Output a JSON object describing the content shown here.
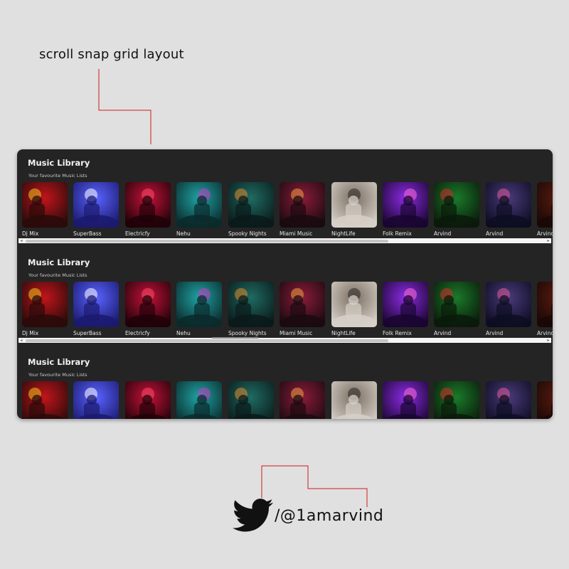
{
  "caption": "scroll snap grid layout",
  "panels": [
    {
      "title": "Music Library",
      "subtitle": "Your favourite Music Lists"
    },
    {
      "title": "Music Library",
      "subtitle": "Your favourite Music Lists"
    },
    {
      "title": "Music Library",
      "subtitle": "Your favourite Music Lists"
    }
  ],
  "cards": [
    {
      "label": "Dj Mix",
      "palette": [
        "#2a0a0a",
        "#c0151b",
        "#f2c21b"
      ],
      "image_icon": "dj-mix-image"
    },
    {
      "label": "SuperBass",
      "palette": [
        "#1b1a6e",
        "#5a63ff",
        "#ffffff"
      ],
      "image_icon": "concert-crowd-image"
    },
    {
      "label": "Electricfy",
      "palette": [
        "#200208",
        "#c4123a",
        "#ff4a6a"
      ],
      "image_icon": "stage-lights-image"
    },
    {
      "label": "Nehu",
      "palette": [
        "#0b2a2c",
        "#1fa3a3",
        "#c83bc4"
      ],
      "image_icon": "singer-portrait-image"
    },
    {
      "label": "Spooky Nights",
      "palette": [
        "#0a1a1a",
        "#1f6b62",
        "#e08a2c"
      ],
      "image_icon": "costume-party-image"
    },
    {
      "label": "Miami Music",
      "palette": [
        "#1a0a10",
        "#8b1b3a",
        "#f0a040"
      ],
      "image_icon": "mixing-console-image"
    },
    {
      "label": "NightLife",
      "palette": [
        "#d6d0c8",
        "#7a6e62",
        "#2a2624"
      ],
      "image_icon": "microphone-singer-image"
    },
    {
      "label": "Folk Remix",
      "palette": [
        "#1a0630",
        "#8a2be2",
        "#ff6ad5"
      ],
      "image_icon": "keyboard-player-image"
    },
    {
      "label": "Arvind",
      "palette": [
        "#0a1a0a",
        "#1b7a2a",
        "#d42a2a"
      ],
      "image_icon": "dj-booth-image"
    },
    {
      "label": "Arvind",
      "palette": [
        "#0d0d22",
        "#4a3a7a",
        "#e05a9a"
      ],
      "image_icon": "festival-crowd-image"
    },
    {
      "label": "Arvind",
      "palette": [
        "#1a0806",
        "#5a1c10",
        "#c04020"
      ],
      "image_icon": "dark-stage-image"
    }
  ],
  "scrollbar": {
    "left_arrow": "◂",
    "right_arrow": "▸"
  },
  "twitter": {
    "handle": "/@1amarvind",
    "icon": "twitter-bird-icon"
  },
  "colors": {
    "connector": "#d11a1a",
    "window_bg": "#242424",
    "page_bg": "#e0e0e0"
  }
}
